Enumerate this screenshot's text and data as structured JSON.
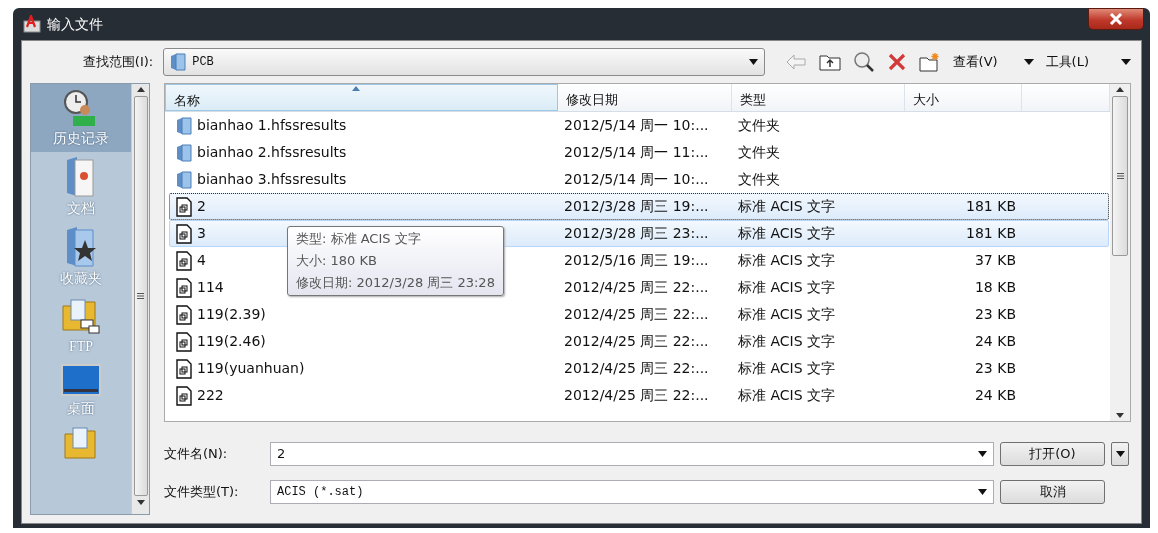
{
  "window": {
    "title": "输入文件"
  },
  "look_in": {
    "label": "查找范围(I):",
    "value": "PCB"
  },
  "toolbar": {
    "view": "查看(V)",
    "tools": "工具(L)"
  },
  "sidebar": {
    "items": [
      {
        "label": "历史记录",
        "kind": "history",
        "selected": true
      },
      {
        "label": "文档",
        "kind": "documents",
        "selected": false
      },
      {
        "label": "收藏夹",
        "kind": "favorites",
        "selected": false
      },
      {
        "label": "FTP",
        "kind": "ftp",
        "selected": false
      },
      {
        "label": "桌面",
        "kind": "desktop",
        "selected": false
      },
      {
        "kind": "folder",
        "selected": false
      }
    ]
  },
  "table": {
    "columns": [
      "名称",
      "修改日期",
      "类型",
      "大小"
    ],
    "rows": [
      {
        "kind": "folder",
        "name": "bianhao 1.hfssresults",
        "date": "2012/5/14 周一 10:...",
        "type": "文件夹",
        "selected": false,
        "focused": false
      },
      {
        "kind": "folder",
        "name": "bianhao 2.hfssresults",
        "date": "2012/5/14 周一 11:...",
        "type": "文件夹",
        "selected": false,
        "focused": false
      },
      {
        "kind": "folder",
        "name": "bianhao 3.hfssresults",
        "date": "2012/5/14 周一 10:...",
        "type": "文件夹",
        "selected": false,
        "focused": false
      },
      {
        "kind": "file",
        "name": "2",
        "date": "2012/3/28 周三 19:...",
        "type": "标准 ACIS 文字",
        "size": "181 KB",
        "selected": true,
        "focused": true
      },
      {
        "kind": "file",
        "name": "3",
        "date": "2012/3/28 周三 23:...",
        "type": "标准 ACIS 文字",
        "size": "181 KB",
        "selected": true,
        "focused": false
      },
      {
        "kind": "file",
        "name": "4",
        "date": "2012/5/16 周三 19:...",
        "type": "标准 ACIS 文字",
        "size": "37 KB",
        "selected": false,
        "focused": false
      },
      {
        "kind": "file",
        "name": "114",
        "date": "2012/4/25 周三 22:...",
        "type": "标准 ACIS 文字",
        "size": "18 KB",
        "selected": false,
        "focused": false
      },
      {
        "kind": "file",
        "name": "119(2.39)",
        "date": "2012/4/25 周三 22:...",
        "type": "标准 ACIS 文字",
        "size": "23 KB",
        "selected": false,
        "focused": false
      },
      {
        "kind": "file",
        "name": "119(2.46)",
        "date": "2012/4/25 周三 22:...",
        "type": "标准 ACIS 文字",
        "size": "24 KB",
        "selected": false,
        "focused": false
      },
      {
        "kind": "file",
        "name": "119(yuanhuan)",
        "date": "2012/4/25 周三 22:...",
        "type": "标准 ACIS 文字",
        "size": "23 KB",
        "selected": false,
        "focused": false
      },
      {
        "kind": "file",
        "name": "222",
        "date": "2012/4/25 周三 22:...",
        "type": "标准 ACIS 文字",
        "size": "24 KB",
        "selected": false,
        "focused": false
      }
    ]
  },
  "tooltip": {
    "lines": [
      "类型: 标准 ACIS 文字",
      "大小: 180 KB",
      "修改日期: 2012/3/28 周三 23:28"
    ]
  },
  "file_name": {
    "label": "文件名(N):",
    "value": "2"
  },
  "file_type": {
    "label": "文件类型(T):",
    "value": "ACIS (*.sat)"
  },
  "buttons": {
    "open": "打开(O)",
    "cancel": "取消"
  }
}
